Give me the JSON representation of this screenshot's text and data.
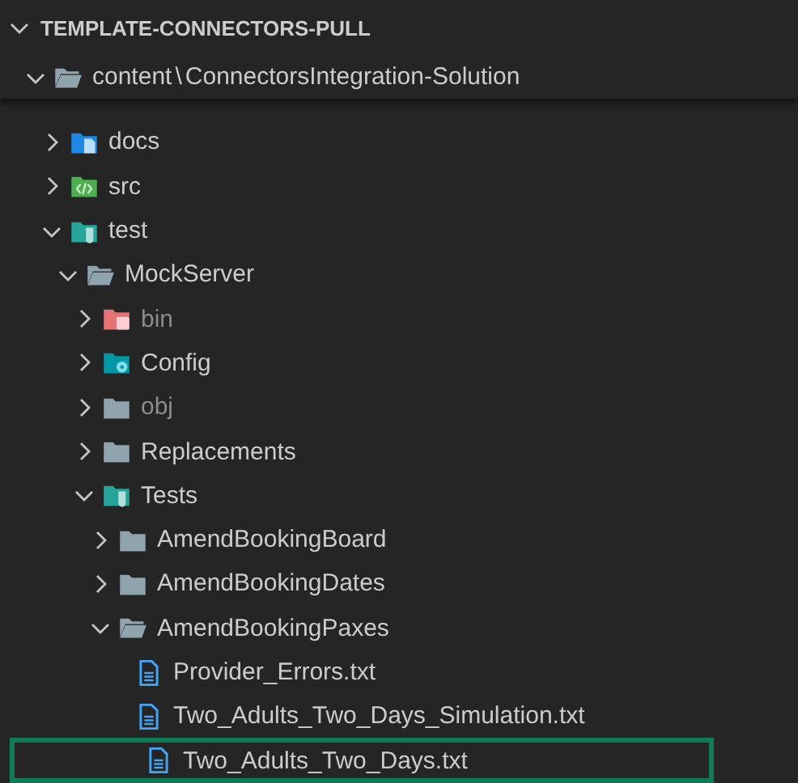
{
  "section": {
    "title": "TEMPLATE-CONNECTORS-PULL",
    "expanded": true
  },
  "tree": [
    {
      "label": "content",
      "path_separator": "\\",
      "path_rest": "ConnectorsIntegration-Solution",
      "expanded": true,
      "children": [
        {
          "label": "docs",
          "kind": "docs",
          "expanded": false,
          "dimmed": false
        },
        {
          "label": "src",
          "kind": "src",
          "expanded": false,
          "dimmed": false
        },
        {
          "label": "test",
          "kind": "test",
          "expanded": true,
          "dimmed": false,
          "children": [
            {
              "label": "MockServer",
              "kind": "folder",
              "expanded": true,
              "dimmed": false,
              "children": [
                {
                  "label": "bin",
                  "kind": "bin",
                  "expanded": false,
                  "dimmed": true
                },
                {
                  "label": "Config",
                  "kind": "config",
                  "expanded": false,
                  "dimmed": false
                },
                {
                  "label": "obj",
                  "kind": "folder",
                  "expanded": false,
                  "dimmed": true
                },
                {
                  "label": "Replacements",
                  "kind": "folder",
                  "expanded": false,
                  "dimmed": false
                },
                {
                  "label": "Tests",
                  "kind": "test",
                  "expanded": true,
                  "dimmed": false,
                  "children": [
                    {
                      "label": "AmendBookingBoard",
                      "kind": "folder",
                      "expanded": false,
                      "dimmed": false
                    },
                    {
                      "label": "AmendBookingDates",
                      "kind": "folder",
                      "expanded": false,
                      "dimmed": false
                    },
                    {
                      "label": "AmendBookingPaxes",
                      "kind": "folder",
                      "expanded": true,
                      "dimmed": false,
                      "children": [
                        {
                          "label": "Provider_Errors.txt",
                          "kind": "file",
                          "highlighted": false
                        },
                        {
                          "label": "Two_Adults_Two_Days_Simulation.txt",
                          "kind": "file",
                          "highlighted": false
                        },
                        {
                          "label": "Two_Adults_Two_Days.txt",
                          "kind": "file",
                          "highlighted": true
                        }
                      ]
                    }
                  ]
                }
              ]
            }
          ]
        }
      ]
    }
  ]
}
